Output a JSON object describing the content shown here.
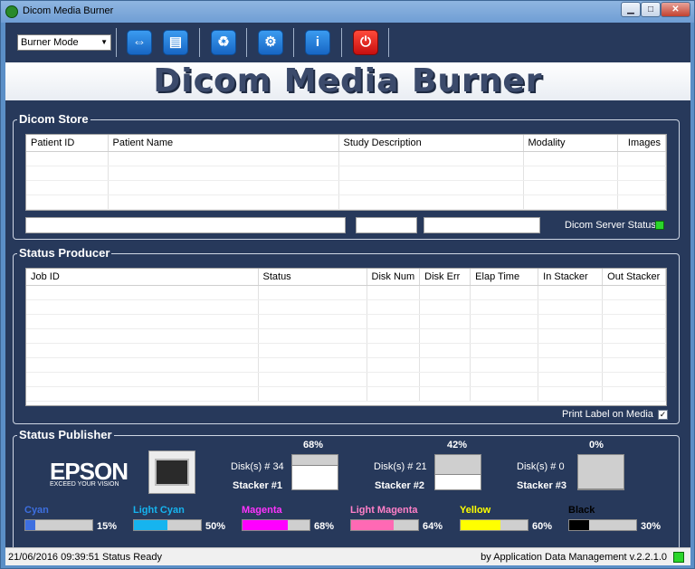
{
  "window": {
    "title": "Dicom Media Burner",
    "close_glyph": "✕",
    "min_glyph": "▁",
    "max_glyph": "□"
  },
  "toolbar": {
    "mode_value": "Burner Mode",
    "buttons": [
      {
        "name": "connect",
        "glyph": "⇔"
      },
      {
        "name": "document",
        "glyph": "▤"
      },
      {
        "name": "recycle",
        "glyph": "♻"
      },
      {
        "name": "settings",
        "glyph": "⚙"
      },
      {
        "name": "info",
        "glyph": "i"
      },
      {
        "name": "power",
        "glyph": "⏻"
      }
    ]
  },
  "banner": {
    "text": "Dicom Media Burner"
  },
  "dicom_store": {
    "title": "Dicom Store",
    "columns": [
      "Patient ID",
      "Patient Name",
      "Study Description",
      "Modality",
      "Images"
    ],
    "server_status_label": "Dicom Server Status"
  },
  "status_producer": {
    "title": "Status Producer",
    "columns": [
      "Job ID",
      "Status",
      "Disk Num",
      "Disk Err",
      "Elap Time",
      "In Stacker",
      "Out Stacker"
    ],
    "print_label": "Print Label on Media",
    "print_label_checked": "✓"
  },
  "status_publisher": {
    "title": "Status Publisher",
    "brand": "EPSON",
    "brand_tagline": "EXCEED YOUR VISION",
    "stackers": [
      {
        "name": "Stacker #1",
        "disks": "Disk(s) # 34",
        "percent": "68%",
        "level": 0.32
      },
      {
        "name": "Stacker #2",
        "disks": "Disk(s) # 21",
        "percent": "42%",
        "level": 0.58
      },
      {
        "name": "Stacker #3",
        "disks": "Disk(s) # 0",
        "percent": "0%",
        "level": 1.0
      }
    ],
    "inks": [
      {
        "name": "Cyan",
        "percent": "15%",
        "level": 15,
        "color": "#3d6fe0",
        "label_color": "#3d6fe0"
      },
      {
        "name": "Light Cyan",
        "percent": "50%",
        "level": 50,
        "color": "#16b4ef",
        "label_color": "#16b4ef"
      },
      {
        "name": "Magenta",
        "percent": "68%",
        "level": 68,
        "color": "#ff00ff",
        "label_color": "#ff33ff"
      },
      {
        "name": "Light Magenta",
        "percent": "64%",
        "level": 64,
        "color": "#ff69b4",
        "label_color": "#ff80c8"
      },
      {
        "name": "Yellow",
        "percent": "60%",
        "level": 60,
        "color": "#ffff00",
        "label_color": "#ffff00"
      },
      {
        "name": "Black",
        "percent": "30%",
        "level": 30,
        "color": "#000000",
        "label_color": "#000000"
      }
    ]
  },
  "statusbar": {
    "left": "21/06/2016 09:39:51  Status Ready",
    "right": "by Application Data Management v.2.2.1.0"
  }
}
